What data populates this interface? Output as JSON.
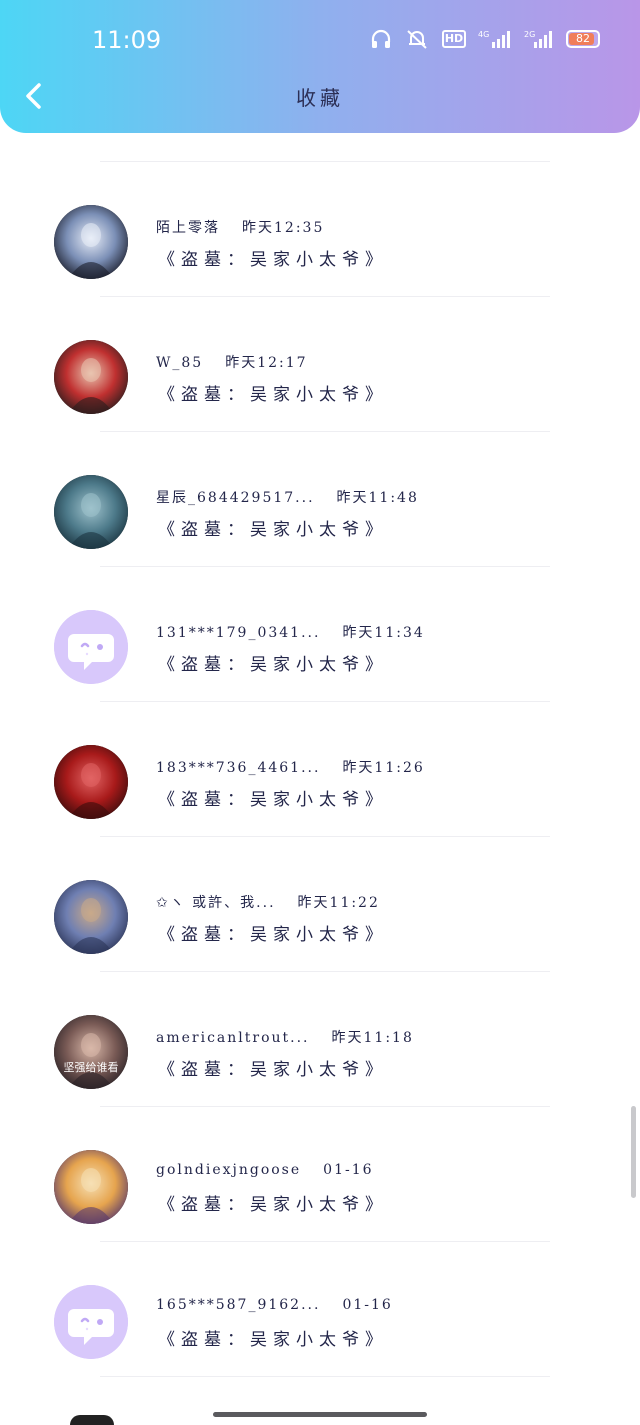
{
  "status_bar": {
    "time": "11:09",
    "hd_label": "HD",
    "net1": "4G",
    "net2": "2G",
    "battery": "82",
    "battery_level": 0.82,
    "battery_color": "#f07e5a"
  },
  "header": {
    "title": "收藏",
    "back_icon": "chevron-left-icon",
    "gradient": [
      "#4dd6f5",
      "#8fb0ee",
      "#b996e8"
    ]
  },
  "items": [
    {
      "name": "陌上零落",
      "time": "昨天12:35",
      "content": "《盗墓：吴家小太爷》",
      "avatar": "photo-girl-white-dress"
    },
    {
      "name": "W_85",
      "time": "昨天12:17",
      "content": "《盗墓：吴家小太爷》",
      "avatar": "photo-anime-boy-red"
    },
    {
      "name": "星辰_684429517...",
      "time": "昨天11:48",
      "content": "《盗墓：吴家小太爷》",
      "avatar": "photo-dark-sky"
    },
    {
      "name": "131***179_0341...",
      "time": "昨天11:34",
      "content": "《盗墓：吴家小太爷》",
      "avatar": "default-chat-face"
    },
    {
      "name": "183***736_4461...",
      "time": "昨天11:26",
      "content": "《盗墓：吴家小太爷》",
      "avatar": "photo-red-robe"
    },
    {
      "name": "✩ヽ 或許、我...",
      "time": "昨天11:22",
      "content": "《盗墓：吴家小太爷》",
      "avatar": "photo-evening-bridge"
    },
    {
      "name": "americanltrout...",
      "time": "昨天11:18",
      "content": "《盗墓：吴家小太爷》",
      "avatar": "photo-girl-portrait",
      "avatar_text": "坚强给谁看"
    },
    {
      "name": "golndiexjngoose",
      "time": "01-16",
      "content": "《盗墓：吴家小太爷》",
      "avatar": "photo-warm-glow"
    },
    {
      "name": "165***587_9162...",
      "time": "01-16",
      "content": "《盗墓：吴家小太爷》",
      "avatar": "default-chat-face"
    }
  ]
}
